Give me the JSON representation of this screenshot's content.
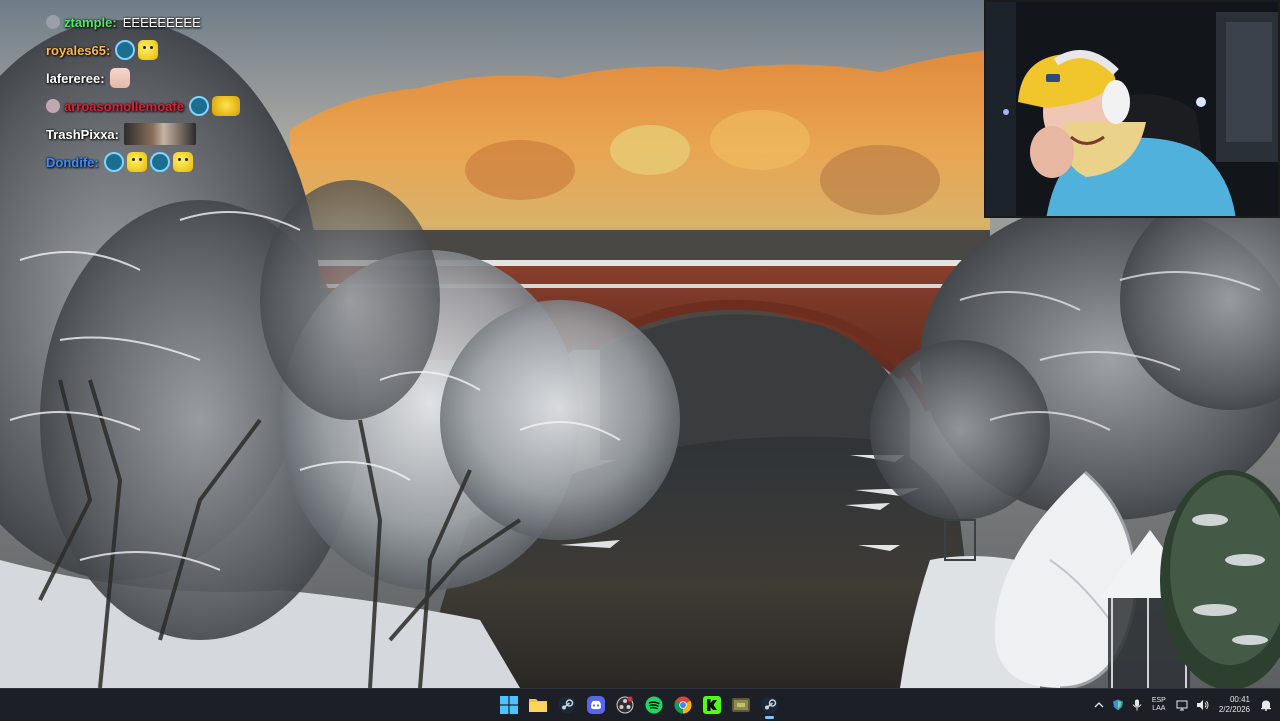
{
  "chat": [
    {
      "user": "ztample:",
      "color": "#4ee86a",
      "message": "EEEEEEEEE",
      "badge_color": "#9aa0a6",
      "emotes": []
    },
    {
      "user": "royales65:",
      "color": "#ffb84a",
      "message": "",
      "badge_color": "",
      "emotes": [
        "mod",
        "smiley"
      ]
    },
    {
      "user": "lafereree:",
      "color": "#ffffff",
      "message": "",
      "badge_color": "",
      "emotes": [
        "pinky"
      ]
    },
    {
      "user": "arroasomollemoafe",
      "color": "#e0203a",
      "message": "",
      "badge_color": "#c0a8b0",
      "emotes": [
        "mod",
        "wide"
      ]
    },
    {
      "user": "TrashPixxa:",
      "color": "#ffffff",
      "message": "",
      "badge_color": "",
      "emotes": [
        "photo"
      ]
    },
    {
      "user": "Dondife:",
      "color": "#3a8cff",
      "message": "",
      "badge_color": "",
      "emotes": [
        "mod",
        "smiley",
        "mod",
        "smiley"
      ]
    }
  ],
  "taskbar": {
    "apps": [
      {
        "name": "start-button",
        "icon": "windows-logo-icon",
        "state": ""
      },
      {
        "name": "file-explorer",
        "icon": "folder-icon",
        "state": ""
      },
      {
        "name": "steam-app",
        "icon": "steam-icon",
        "state": ""
      },
      {
        "name": "discord-app",
        "icon": "discord-icon",
        "state": ""
      },
      {
        "name": "obs-app",
        "icon": "record-icon",
        "state": ""
      },
      {
        "name": "spotify-app",
        "icon": "spotify-icon",
        "state": ""
      },
      {
        "name": "chrome-app",
        "icon": "chrome-icon",
        "state": ""
      },
      {
        "name": "kick-app",
        "icon": "kick-icon",
        "state": ""
      },
      {
        "name": "game-app",
        "icon": "game-icon",
        "state": ""
      },
      {
        "name": "steam-app-2",
        "icon": "steam-icon",
        "state": "active"
      }
    ],
    "tray": {
      "language_top": "ESP",
      "language_bottom": "LAA",
      "time": "00:41",
      "date": "2/2/2026"
    }
  },
  "colors": {
    "taskbar_bg": "#1c1f26",
    "accent": "#7fc3ff"
  }
}
